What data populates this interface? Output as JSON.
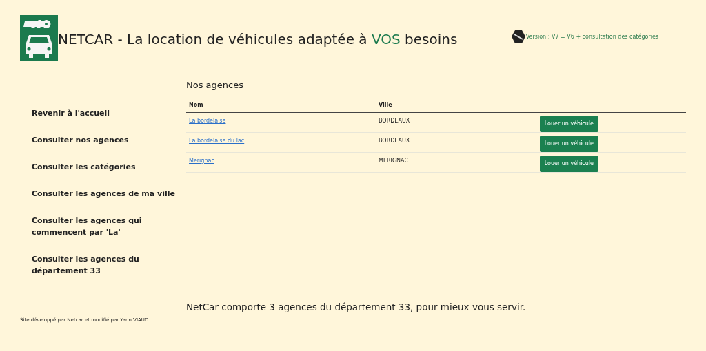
{
  "header": {
    "title_before": "NETCAR - La location de véhicules adaptée à ",
    "title_highlight": "VOS",
    "title_after": " besoins",
    "version": "Version : V7 = V6 + consultation des catégories"
  },
  "sidebar": {
    "items": [
      {
        "label": "Revenir à l'accueil"
      },
      {
        "label": "Consulter nos agences"
      },
      {
        "label": "Consulter les catégories"
      },
      {
        "label": "Consulter les agences de ma ville"
      },
      {
        "label": "Consulter les agences qui commencent par 'La'"
      },
      {
        "label": "Consulter les agences du département 33"
      }
    ]
  },
  "main": {
    "heading": "Nos agences",
    "table": {
      "columns": [
        "Nom",
        "Ville"
      ],
      "rows": [
        {
          "name": "La bordelaise",
          "city": "BORDEAUX",
          "action": "Louer un véhicule"
        },
        {
          "name": "La bordelaise du lac",
          "city": "BORDEAUX",
          "action": "Louer un véhicule"
        },
        {
          "name": "Merignac",
          "city": "MERIGNAC",
          "action": "Louer un véhicule"
        }
      ]
    },
    "summary": "NetCar comporte 3 agences du département 33, pour mieux vous servir."
  },
  "footer": {
    "credit": "Site développé par Netcar et modifié par Yann VIAUD"
  }
}
